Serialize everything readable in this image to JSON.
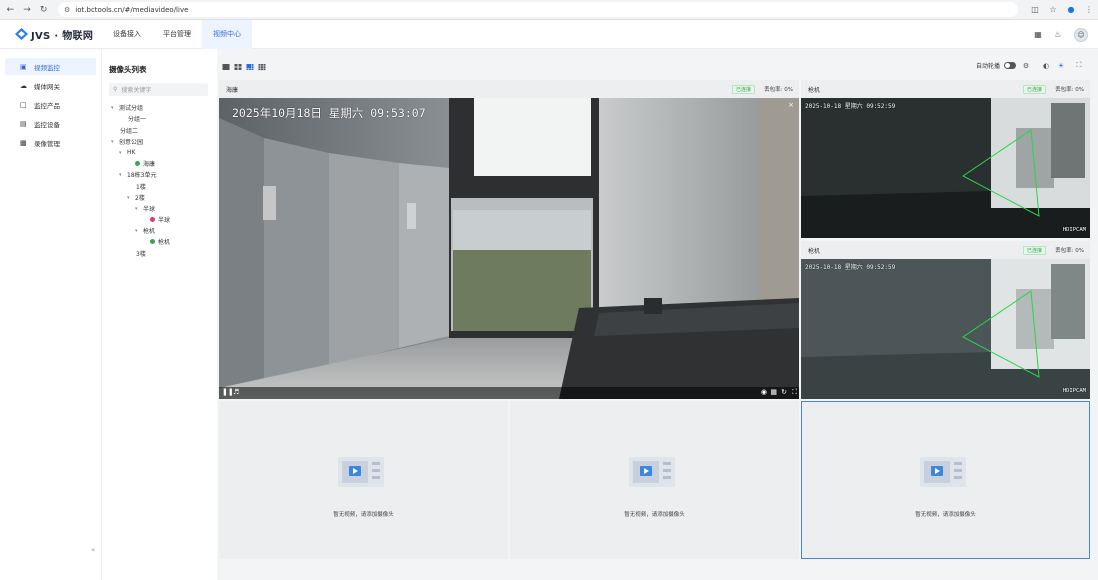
{
  "browser": {
    "url": "iot.bctools.cn/#/mediavideo/live"
  },
  "topnav": {
    "logo_text": "JVS · 物联网",
    "menu": [
      {
        "label": "设备接入"
      },
      {
        "label": "平台管理"
      },
      {
        "label": "视频中心"
      }
    ]
  },
  "sidebar": {
    "items": [
      {
        "label": "视频监控",
        "icon": "monitor-icon"
      },
      {
        "label": "媒体网关",
        "icon": "gateway-icon"
      },
      {
        "label": "监控产品",
        "icon": "product-icon"
      },
      {
        "label": "监控设备",
        "icon": "device-icon"
      },
      {
        "label": "录像管理",
        "icon": "record-icon"
      }
    ],
    "collapse_label": "«"
  },
  "tree": {
    "title": "摄像头列表",
    "search_placeholder": "搜索关键字",
    "nodes": [
      {
        "label": "测试分组",
        "caret": "▾"
      },
      {
        "label": "分组一",
        "caret": ""
      },
      {
        "label": "分组二",
        "caret": ""
      },
      {
        "label": "创意公园",
        "caret": "▾"
      },
      {
        "label": "HK",
        "caret": "▾"
      },
      {
        "label": "海康",
        "caret": ""
      },
      {
        "label": "18栋3单元",
        "caret": "▾"
      },
      {
        "label": "1楼",
        "caret": ""
      },
      {
        "label": "2楼",
        "caret": "▾"
      },
      {
        "label": "半球",
        "caret": "▾"
      },
      {
        "label": "半球",
        "caret": ""
      },
      {
        "label": "枪机",
        "caret": "▾"
      },
      {
        "label": "枪机",
        "caret": ""
      },
      {
        "label": "3楼",
        "caret": ""
      }
    ]
  },
  "toolbar": {
    "auto_rotate_label": "自动轮播"
  },
  "panes": {
    "main": {
      "title": "海康",
      "status": "已连接",
      "loss": "丢包率: 0%",
      "osd": "2025年10月18日  星期六  09:53:07",
      "close": "×"
    },
    "right_top": {
      "title": "枪机",
      "status": "已连接",
      "loss": "丢包率: 0%",
      "osd": "2025-10-18 星期六 09:52:59",
      "brand": "HDIPCAM"
    },
    "right_bottom": {
      "title": "枪机",
      "status": "已连接",
      "loss": "丢包率: 0%",
      "osd": "2025-10-18 星期六 09:52:59",
      "brand": "HDIPCAM"
    },
    "empty_text": "暂无视频，请添加摄像头"
  },
  "colors": {
    "accent": "#2f6bd6",
    "online": "#3aa455",
    "alert": "#e03a6a",
    "selected_border": "#4a82d9"
  }
}
